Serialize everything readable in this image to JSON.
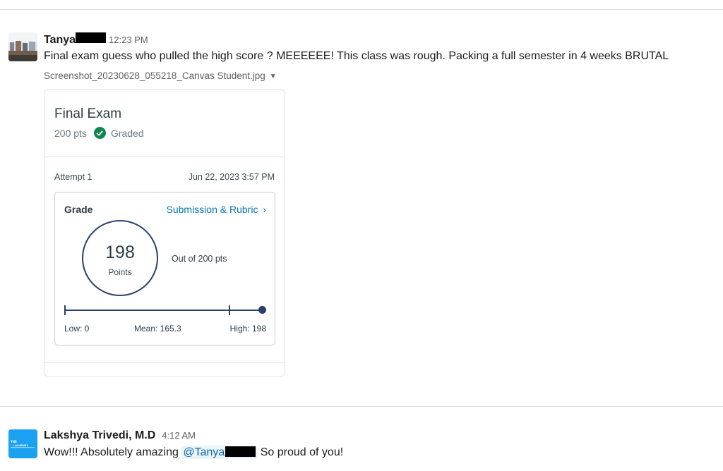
{
  "colors": {
    "accent_link": "#0374b5",
    "graded_green": "#0b874b",
    "score_navy": "#2b3f6c",
    "mention_bg": "#e8f5fa"
  },
  "message1": {
    "author": "Tanya",
    "timestamp": "12:23 PM",
    "text": "Final exam  guess who pulled the high score ? MEEEEEE! This class was rough. Packing a full semester in 4 weeks BRUTAL",
    "attachment": {
      "file_name": "Screenshot_20230628_055218_Canvas Student.jpg",
      "caret_icon": "caret-down-icon",
      "assignment_title": "Final Exam",
      "points": "200 pts",
      "status_icon": "check-circle-icon",
      "status": "Graded",
      "attempt": "Attempt 1",
      "attempt_date": "Jun 22, 2023 3:57 PM",
      "grade_label": "Grade",
      "rubric_link": "Submission & Rubric",
      "rubric_icon": "chevron-right-icon",
      "score": "198",
      "score_unit": "Points",
      "out_of": "Out of 200 pts",
      "stats": {
        "low": "Low: 0",
        "mean": "Mean: 165.3",
        "high": "High: 198"
      },
      "stat_values": {
        "low": 0,
        "mean": 165.3,
        "high": 198,
        "max": 200,
        "score": 198
      }
    }
  },
  "message2": {
    "author": "Lakshya Trivedi, M.D",
    "timestamp": "4:12 AM",
    "text_before": "Wow!!! Absolutely amazing ",
    "mention": "@Tanya",
    "text_after": " So proud of you!",
    "avatar_text": "THE ... JOURNEY"
  }
}
